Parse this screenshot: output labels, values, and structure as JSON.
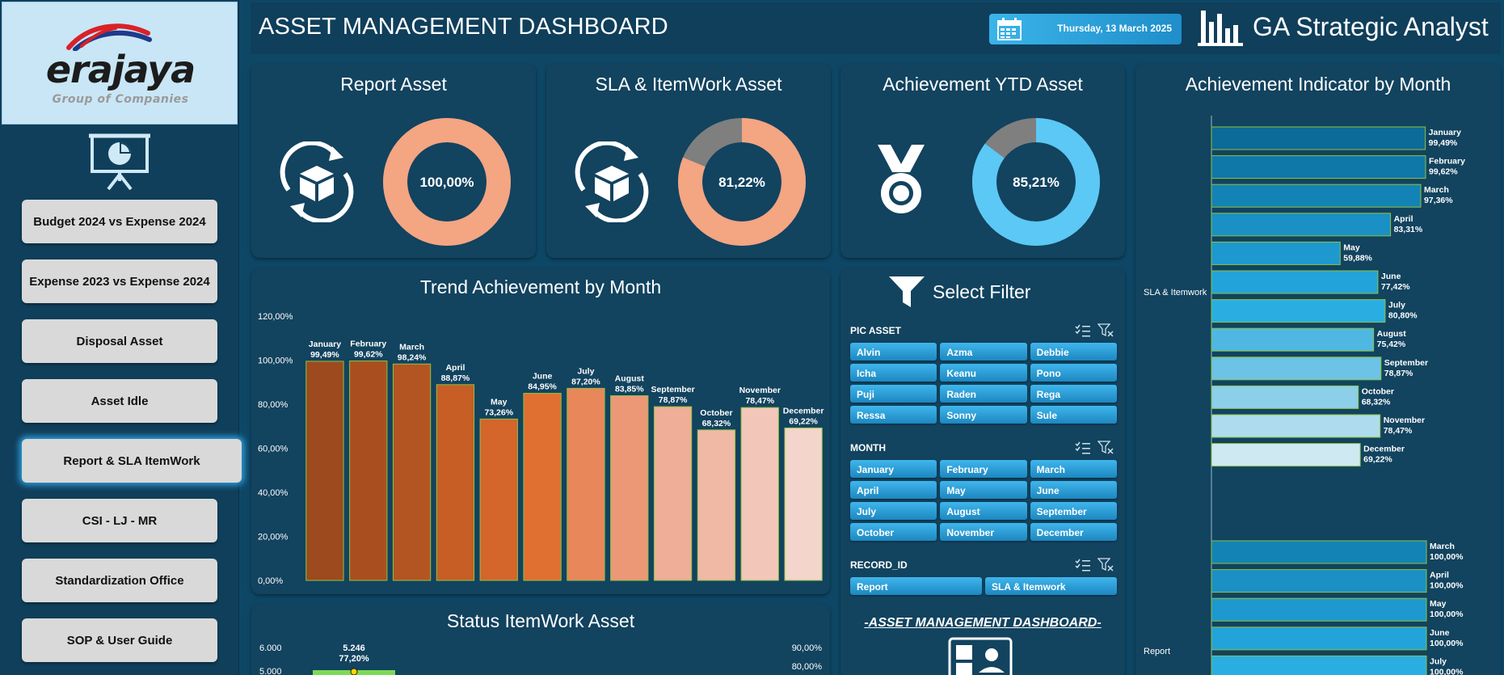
{
  "header": {
    "title": "ASSET MANAGEMENT DASHBOARD",
    "date": "Thursday, 13 March 2025",
    "brand": "GA Strategic Analyst"
  },
  "sidebar": {
    "logo_text": "erajaya",
    "logo_sub": "Group of Companies",
    "items": [
      {
        "label": "Budget 2024 vs Expense 2024"
      },
      {
        "label": "Expense 2023 vs Expense 2024"
      },
      {
        "label": "Disposal Asset"
      },
      {
        "label": "Asset Idle"
      },
      {
        "label": "Report & SLA ItemWork",
        "active": true
      },
      {
        "label": "CSI - LJ - MR"
      },
      {
        "label": "Standardization Office"
      },
      {
        "label": "SOP & User Guide"
      }
    ]
  },
  "kpis": [
    {
      "title": "Report Asset",
      "value": "100,00%",
      "fraction": 1.0,
      "color": "#f4a582",
      "icon": "box-cycle-icon"
    },
    {
      "title": "SLA & ItemWork Asset",
      "value": "81,22%",
      "fraction": 0.8122,
      "color": "#f4a582",
      "icon": "box-cycle-icon"
    },
    {
      "title": "Achievement YTD Asset",
      "value": "85,21%",
      "fraction": 0.8521,
      "color": "#5bc8f5",
      "icon": "medal-icon"
    }
  ],
  "trend": {
    "title": "Trend Achievement by Month",
    "chart_data": {
      "type": "bar",
      "categories": [
        "January",
        "February",
        "March",
        "April",
        "May",
        "June",
        "July",
        "August",
        "September",
        "October",
        "November",
        "December"
      ],
      "values": [
        99.49,
        99.62,
        98.24,
        88.87,
        73.26,
        84.95,
        87.2,
        83.85,
        78.87,
        68.32,
        78.47,
        69.22
      ],
      "labels": [
        "99,49%",
        "99,62%",
        "98,24%",
        "88,87%",
        "73,26%",
        "84,95%",
        "87,20%",
        "83,85%",
        "78,87%",
        "68,32%",
        "78,47%",
        "69,22%"
      ],
      "yticks": [
        "0,00%",
        "20,00%",
        "40,00%",
        "60,00%",
        "80,00%",
        "100,00%",
        "120,00%"
      ],
      "ylim": [
        0,
        120
      ],
      "colors": [
        "#9c4a1e",
        "#a94f1f",
        "#b35522",
        "#c65e25",
        "#d4652b",
        "#e06f32",
        "#e8875a",
        "#ec9876",
        "#efae97",
        "#f0b9a6",
        "#f2c7ba",
        "#f4d5cb"
      ]
    }
  },
  "status": {
    "title": "Status ItemWork Asset",
    "left_ticks": [
      "6.000",
      "5.000"
    ],
    "right_ticks": [
      "90,00%",
      "80,00%"
    ],
    "bar_value": "5.246",
    "bar_pct": "77,20%"
  },
  "filter": {
    "title": "Select Filter",
    "groups": [
      {
        "label": "PIC ASSET",
        "items": [
          "Alvin",
          "Azma",
          "Debbie",
          "Icha",
          "Keanu",
          "Pono",
          "Puji",
          "Raden",
          "Rega",
          "Ressa",
          "Sonny",
          "Sule"
        ]
      },
      {
        "label": "MONTH",
        "items": [
          "January",
          "February",
          "March",
          "April",
          "May",
          "June",
          "July",
          "August",
          "September",
          "October",
          "November",
          "December"
        ]
      },
      {
        "label": "RECORD_ID",
        "items": [
          "Report",
          "SLA & Itemwork"
        ]
      }
    ],
    "footer_title": "-ASSET MANAGEMENT DASHBOARD-"
  },
  "indicator": {
    "title": "Achievement Indicator by Month",
    "chart_data": {
      "type": "bar",
      "orientation": "horizontal",
      "groups": [
        {
          "name": "SLA & Itemwork",
          "categories": [
            "January",
            "February",
            "March",
            "April",
            "May",
            "June",
            "July",
            "August",
            "September",
            "October",
            "November",
            "December"
          ],
          "values": [
            99.49,
            99.62,
            97.36,
            83.31,
            59.88,
            77.42,
            80.8,
            75.42,
            78.87,
            68.32,
            78.47,
            69.22
          ],
          "labels": [
            "99,49%",
            "99,62%",
            "97,36%",
            "83,31%",
            "59,88%",
            "77,42%",
            "80,80%",
            "75,42%",
            "78,87%",
            "68,32%",
            "78,47%",
            "69,22%"
          ]
        },
        {
          "name": "Report",
          "categories": [
            "March",
            "April",
            "May",
            "June",
            "July"
          ],
          "values": [
            100.0,
            100.0,
            100.0,
            100.0,
            100.0
          ],
          "labels": [
            "100,00%",
            "100,00%",
            "100,00%",
            "100,00%",
            "100,00%"
          ]
        }
      ],
      "colors": [
        "#0d6b98",
        "#0f78a8",
        "#1383b5",
        "#1a90c4",
        "#1d99cf",
        "#22a4da",
        "#2aaee2",
        "#4fb8e2",
        "#6cc3e6",
        "#8ccfe9",
        "#aedced",
        "#cfe9f2"
      ]
    }
  }
}
